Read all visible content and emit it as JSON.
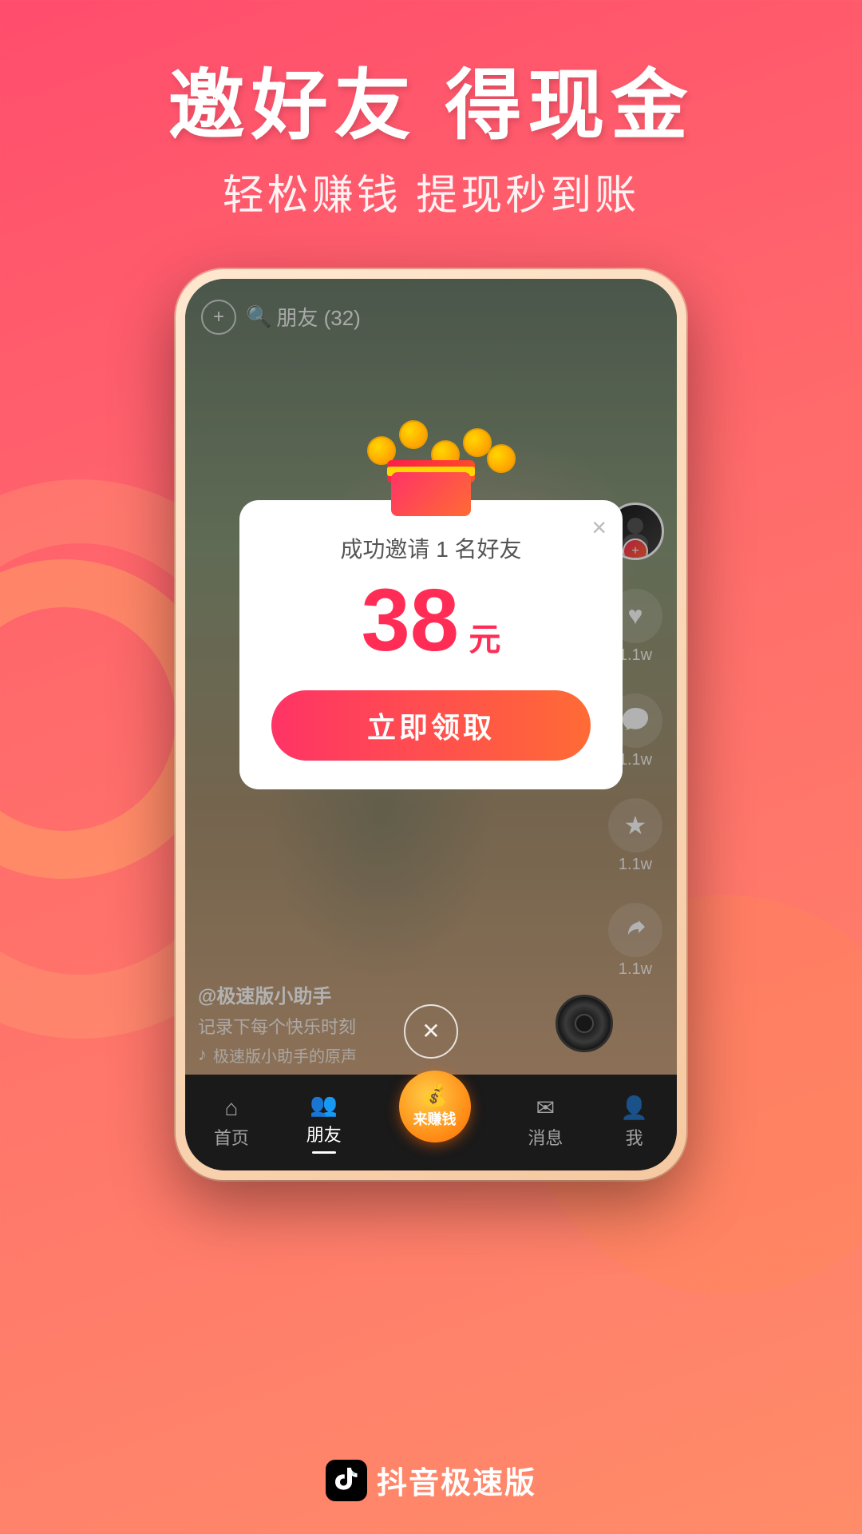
{
  "background": {
    "gradient_start": "#ff4d6d",
    "gradient_end": "#ff8c69"
  },
  "header": {
    "main_title": "邀好友 得现金",
    "sub_title": "轻松赚钱 提现秒到账"
  },
  "phone": {
    "topbar": {
      "add_label": "+",
      "search_label": "朋友 (32)"
    },
    "modal": {
      "close_icon": "×",
      "subtitle": "成功邀请 1 名好友",
      "amount": "38",
      "unit": "元",
      "claim_button": "立即领取"
    },
    "video_info": {
      "author": "@极速版小助手",
      "description": "记录下每个快乐时刻",
      "music": "极速版小助手的原声"
    },
    "side_actions": [
      {
        "icon": "♥",
        "label": "1.1w"
      },
      {
        "icon": "💬",
        "label": "1.1w"
      },
      {
        "icon": "★",
        "label": "1.1w"
      },
      {
        "icon": "↪",
        "label": "1.1w"
      }
    ],
    "navbar": [
      {
        "label": "首页",
        "active": false
      },
      {
        "label": "朋友",
        "active": true
      },
      {
        "label": "来赚钱",
        "active": false,
        "center": true
      },
      {
        "label": "消息",
        "active": false
      },
      {
        "label": "我",
        "active": false
      }
    ]
  },
  "footer": {
    "app_name": "抖音极速版"
  }
}
